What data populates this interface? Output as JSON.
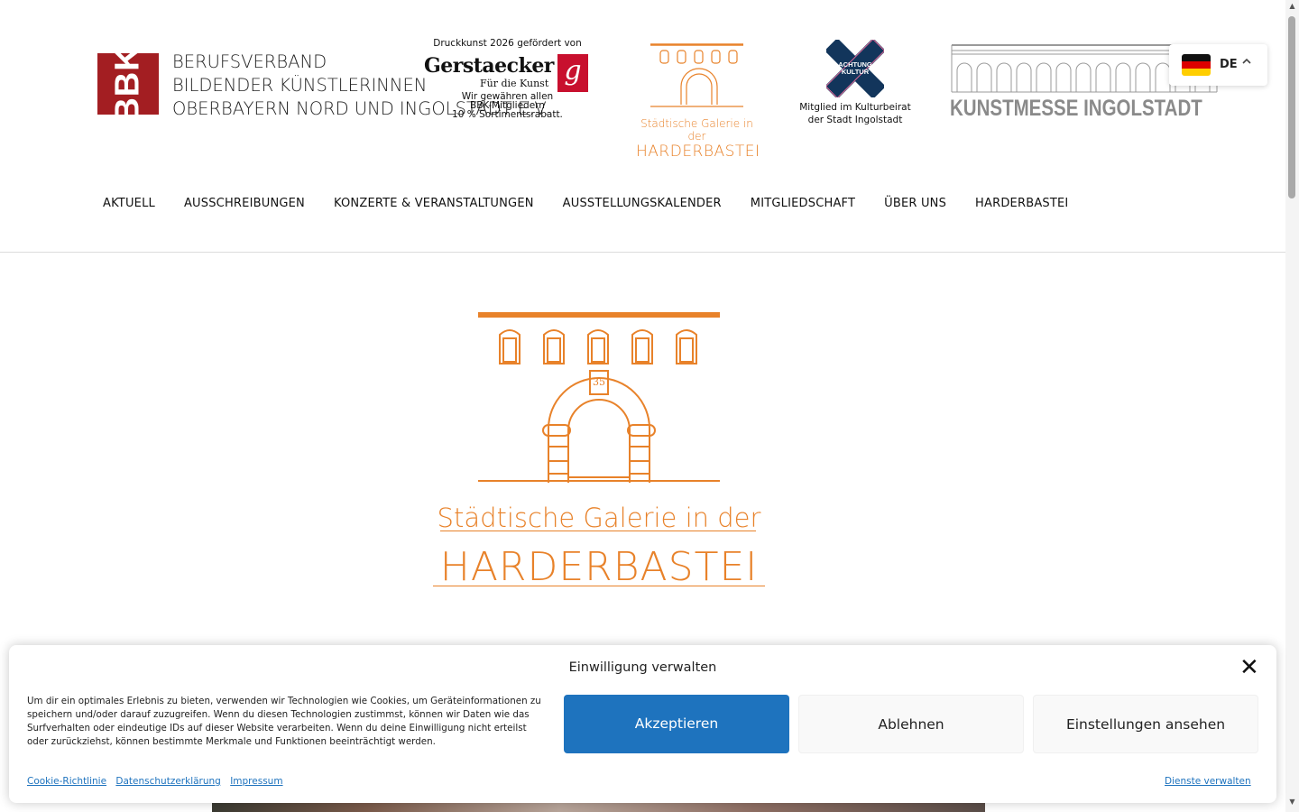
{
  "header": {
    "logo_text": "BBK",
    "org_name_line1": "BERUFSVERBAND",
    "org_name_line2": "BILDENDER KÜNSTLERINNEN U",
    "org_name_line3": "OBERBAYERN NORD UND INGOLSTADT E.V.",
    "sponsor_top": "Druckkunst 2026 gefördert von",
    "sponsor_name": "Gerstaecker",
    "sponsor_subtitle": "Für die Kunst",
    "sponsor_badge": "g",
    "sponsor_rabatt_1": "Wir gewähren allen",
    "sponsor_rabatt_2": "BBK-Mitgliedern",
    "sponsor_rabatt_3": "10 % Sortimentsrabatt.",
    "gallery_caption1": "Städtische Galerie in der",
    "gallery_caption2": "HARDERBASTEI",
    "kultur_logo_text1": "ACHTUNG",
    "kultur_logo_text2": "KULTUR",
    "kultur_caption1": "Mitglied im Kulturbeirat",
    "kultur_caption2": "der Stadt Ingolstadt",
    "kunstmesse_text": "KUNSTMESSE INGOLSTADT",
    "lang_code": "DE"
  },
  "nav": {
    "items": [
      {
        "label": "AKTUELL"
      },
      {
        "label": "AUSSCHREIBUNGEN"
      },
      {
        "label": "KONZERTE & VERANSTALTUNGEN"
      },
      {
        "label": "AUSSTELLUNGSKALENDER"
      },
      {
        "label": "MITGLIEDSCHAFT"
      },
      {
        "label": "ÜBER UNS"
      },
      {
        "label": "HARDERBASTEI"
      }
    ]
  },
  "main": {
    "gallery_caption1": "Städtische Galerie in der",
    "gallery_caption2": "HARDERBASTEI",
    "gallery_number": "35"
  },
  "cookie": {
    "title": "Einwilligung verwalten",
    "message": "Um dir ein optimales Erlebnis zu bieten, verwenden wir Technologien wie Cookies, um Geräteinformationen zu speichern und/oder darauf zuzugreifen. Wenn du diesen Technologien zustimmst, können wir Daten wie das Surfverhalten oder eindeutige IDs auf dieser Website verarbeiten. Wenn du deine Einwilligung nicht erteilst oder zurückziehst, können bestimmte Merkmale und Funktionen beeinträchtigt werden.",
    "accept": "Akzeptieren",
    "deny": "Ablehnen",
    "view_settings": "Einstellungen ansehen",
    "link_cookie": "Cookie-Richtlinie",
    "link_privacy": "Datenschutzerklärung",
    "link_imprint": "Impressum",
    "manage_services": "Dienste verwalten",
    "close_symbol": "✕"
  },
  "colors": {
    "bbk_red": "#a31e22",
    "gallery_orange": "#e8822a",
    "accept_blue": "#1e73be",
    "kultur_navy": "#12355b"
  }
}
